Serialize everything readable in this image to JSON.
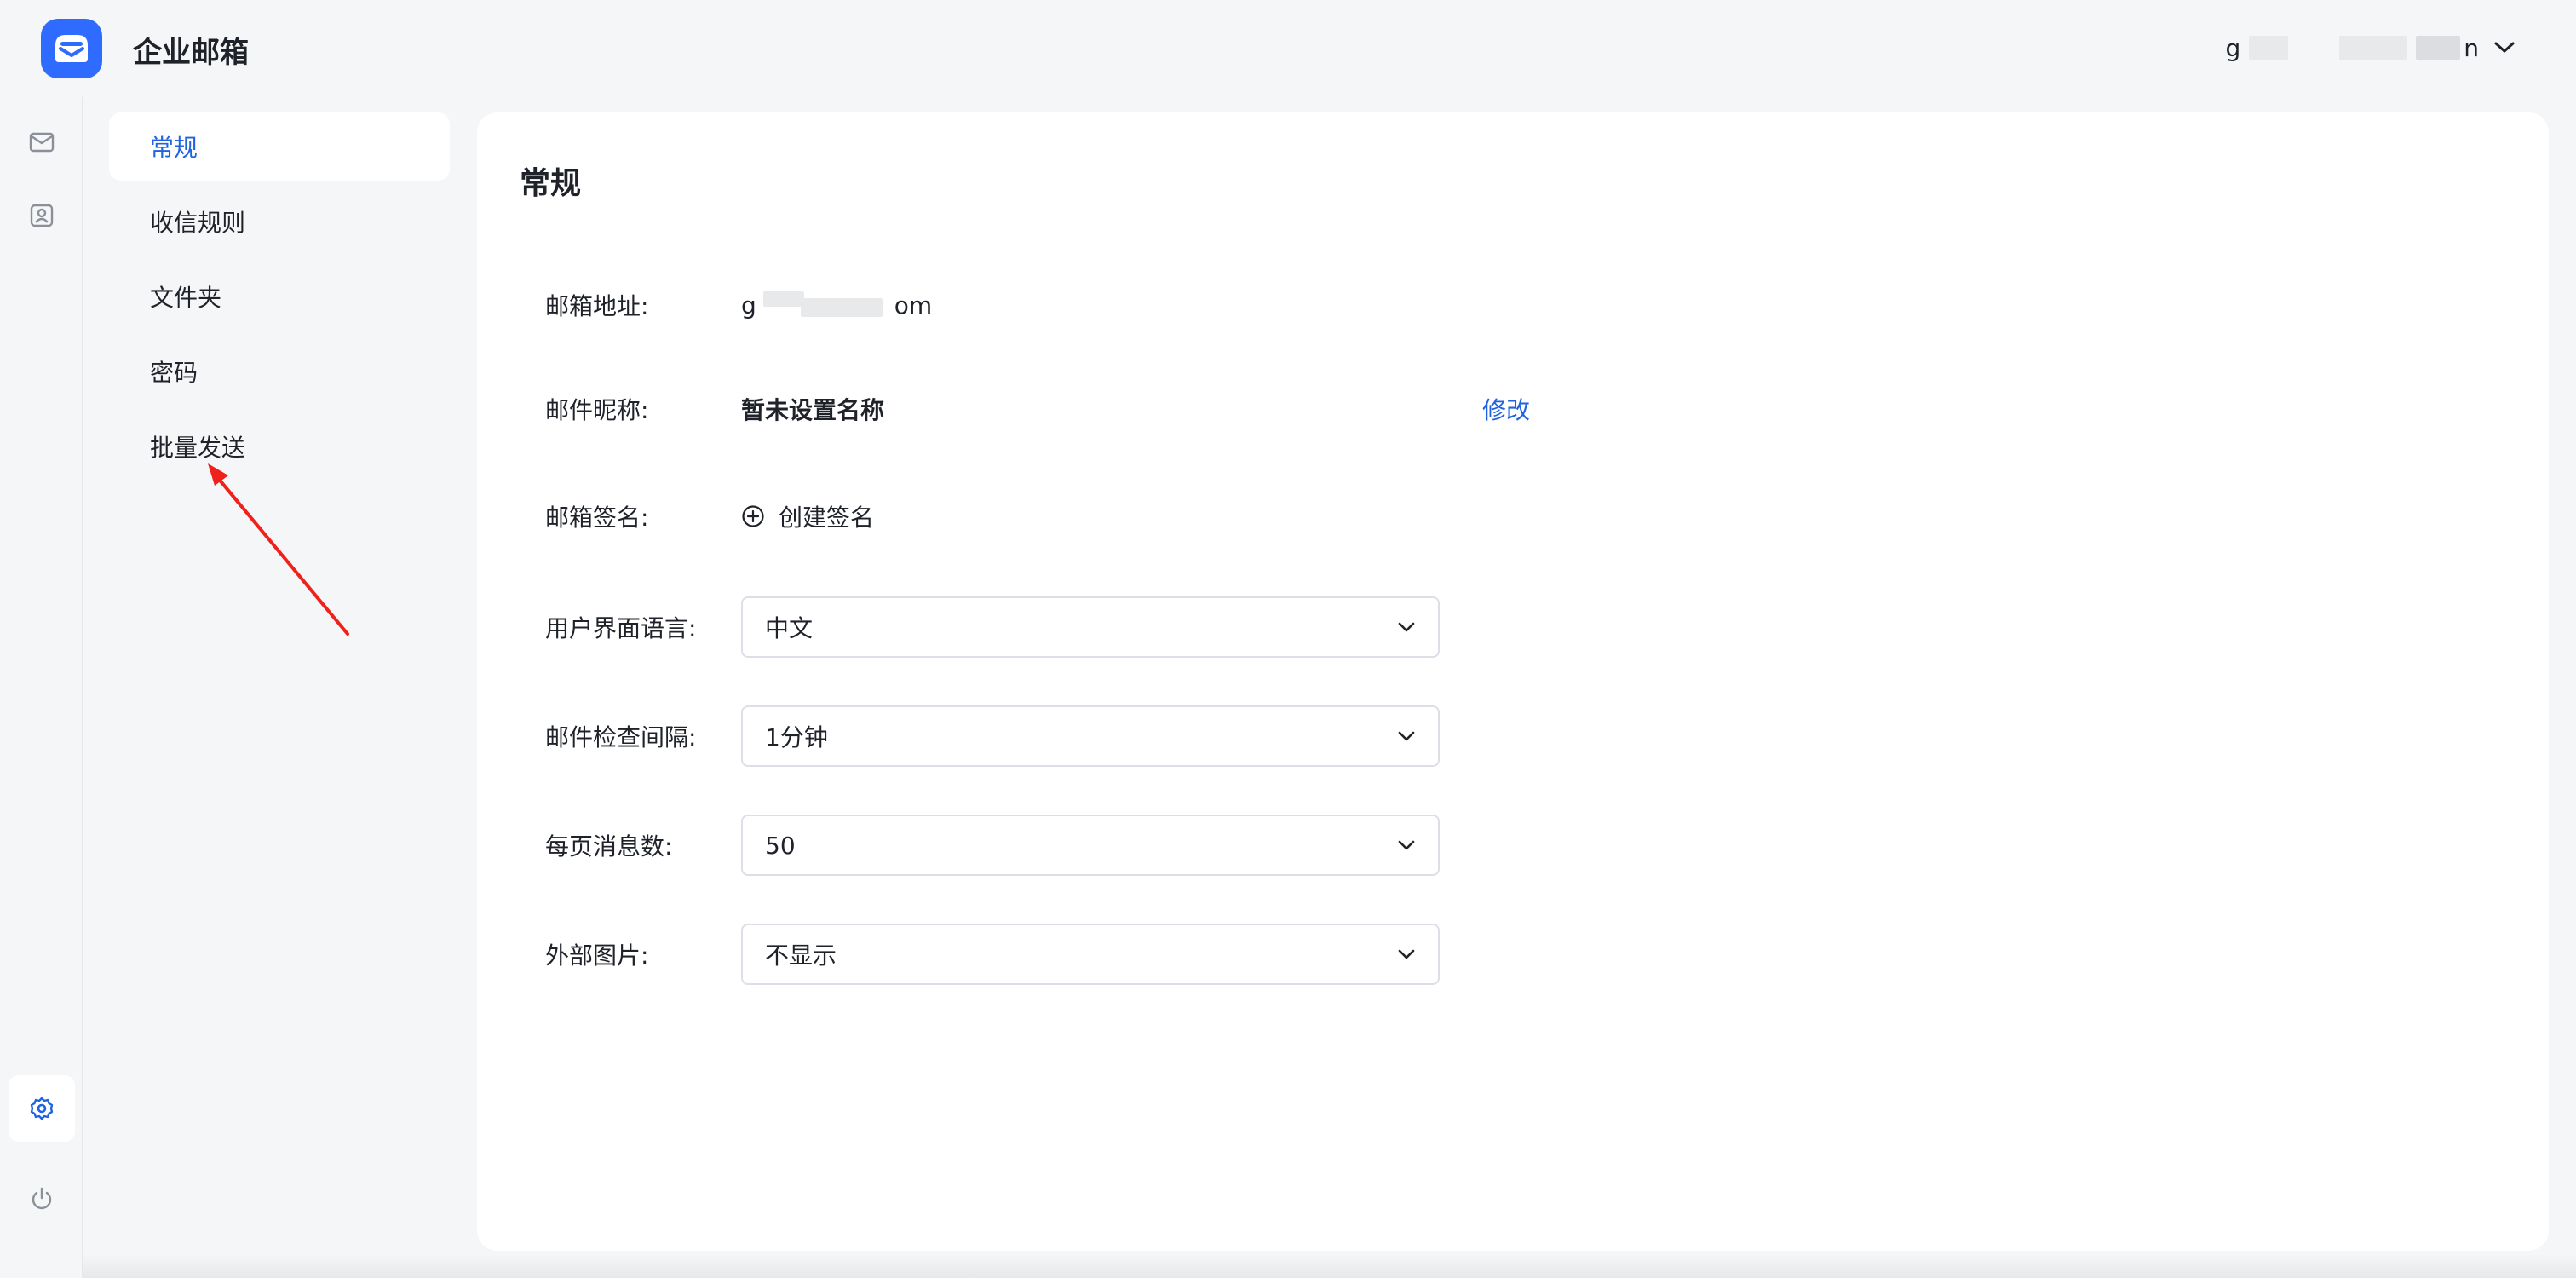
{
  "app": {
    "title": "企业邮箱",
    "brand_color": "#2f6bff",
    "accent_link_color": "#1f63e0"
  },
  "header": {
    "user_email_parts": [
      "g",
      "n"
    ],
    "dropdown_icon": "chevron-down-icon"
  },
  "rail": {
    "items": [
      {
        "name": "mail",
        "icon": "mail-icon"
      },
      {
        "name": "contacts",
        "icon": "contact-card-icon"
      },
      {
        "name": "settings",
        "icon": "gear-icon",
        "active": true
      },
      {
        "name": "logout",
        "icon": "power-icon"
      }
    ]
  },
  "nav": {
    "items": [
      {
        "label": "常规",
        "active": true
      },
      {
        "label": "收信规则"
      },
      {
        "label": "文件夹"
      },
      {
        "label": "密码"
      },
      {
        "label": "批量发送"
      }
    ]
  },
  "main": {
    "title": "常规",
    "email": {
      "label": "邮箱地址:",
      "value_start": "g",
      "value_end": "om"
    },
    "nickname": {
      "label": "邮件昵称:",
      "value": "暂未设置名称",
      "action": "修改"
    },
    "signature": {
      "label": "邮箱签名:",
      "action": "创建签名",
      "icon": "plus-circle-icon"
    },
    "language": {
      "label": "用户界面语言:",
      "value": "中文"
    },
    "check_interval": {
      "label": "邮件检查间隔:",
      "value": "1分钟"
    },
    "per_page": {
      "label": "每页消息数:",
      "value": "50"
    },
    "external_images": {
      "label": "外部图片:",
      "value": "不显示"
    }
  }
}
